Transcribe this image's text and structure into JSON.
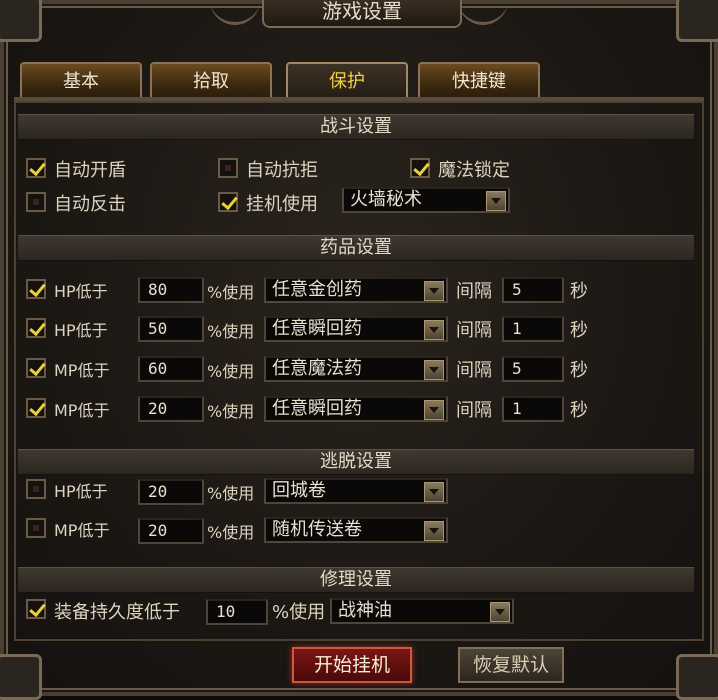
{
  "window": {
    "title": "游戏设置"
  },
  "tabs": [
    {
      "label": "基本",
      "active": false
    },
    {
      "label": "拾取",
      "active": false
    },
    {
      "label": "保护",
      "active": true
    },
    {
      "label": "快捷键",
      "active": false
    }
  ],
  "combat": {
    "title": "战斗设置",
    "auto_shield": {
      "label": "自动开盾",
      "checked": true
    },
    "auto_resist": {
      "label": "自动抗拒",
      "checked": false
    },
    "magic_lock": {
      "label": "魔法锁定",
      "checked": true
    },
    "auto_counter": {
      "label": "自动反击",
      "checked": false
    },
    "auto_use": {
      "label": "挂机使用",
      "checked": true,
      "skill": "火墙秘术"
    }
  },
  "potions": {
    "title": "药品设置",
    "use_label": "%使用",
    "interval_label": "间隔",
    "seconds_label": "秒",
    "rows": [
      {
        "label": "HP低于",
        "checked": true,
        "threshold": "80",
        "item": "任意金创药",
        "interval": "5"
      },
      {
        "label": "HP低于",
        "checked": true,
        "threshold": "50",
        "item": "任意瞬回药",
        "interval": "1"
      },
      {
        "label": "MP低于",
        "checked": true,
        "threshold": "60",
        "item": "任意魔法药",
        "interval": "5"
      },
      {
        "label": "MP低于",
        "checked": true,
        "threshold": "20",
        "item": "任意瞬回药",
        "interval": "1"
      }
    ]
  },
  "escape": {
    "title": "逃脱设置",
    "use_label": "%使用",
    "rows": [
      {
        "label": "HP低于",
        "checked": false,
        "threshold": "20",
        "item": "回城卷"
      },
      {
        "label": "MP低于",
        "checked": false,
        "threshold": "20",
        "item": "随机传送卷"
      }
    ]
  },
  "repair": {
    "title": "修理设置",
    "label": "装备持久度低于",
    "checked": true,
    "threshold": "10",
    "use_label": "%使用",
    "item": "战神油"
  },
  "buttons": {
    "start": "开始挂机",
    "reset": "恢复默认"
  },
  "colors": {
    "check": "#e8d13a",
    "active_tab_text": "#f2d23a",
    "start_button": "#7a1612"
  }
}
